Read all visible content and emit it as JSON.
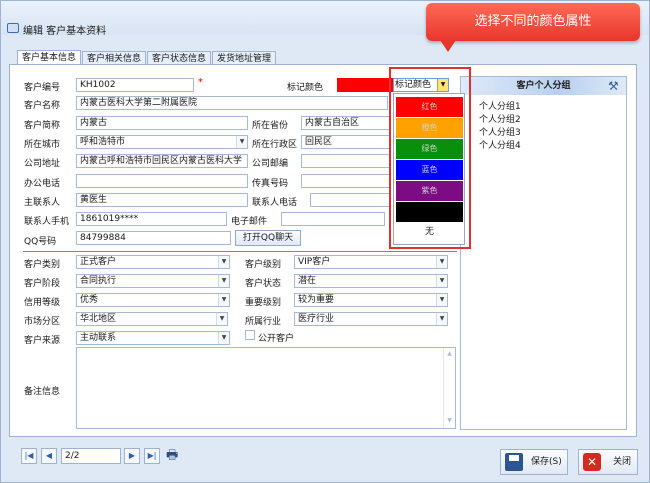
{
  "window": {
    "title": "编辑 客户基本资料"
  },
  "callout": {
    "text": "选择不同的颜色属性"
  },
  "tabs": [
    {
      "label": "客户基本信息"
    },
    {
      "label": "客户相关信息"
    },
    {
      "label": "客户状态信息"
    },
    {
      "label": "发货地址管理"
    }
  ],
  "form": {
    "customer_no_label": "客户编号",
    "customer_no": "KH1002",
    "mark_color_label": "标记颜色",
    "mark_color_value": "标记颜色",
    "customer_name_label": "客户名称",
    "customer_name": "内蒙古医科大学第二附属医院",
    "short_name_label": "客户简称",
    "short_name": "内蒙古",
    "province_label": "所在省份",
    "province": "内蒙古自治区",
    "city_label": "所在城市",
    "city": "呼和浩特市",
    "district_label": "所在行政区",
    "district": "回民区",
    "address_label": "公司地址",
    "address": "内蒙古呼和浩特市回民区内蒙古医科大学",
    "postcode_label": "公司邮编",
    "postcode": "",
    "office_phone_label": "办公电话",
    "office_phone": "",
    "fax_label": "传真号码",
    "fax": "",
    "contact_label": "主联系人",
    "contact": "黄医生",
    "contact_phone_label": "联系人电话",
    "contact_phone": "",
    "mobile_label": "联系人手机",
    "mobile": "1861019****",
    "email_label": "电子邮件",
    "email": "",
    "qq_label": "QQ号码",
    "qq": "84799884",
    "qq_button": "打开QQ聊天",
    "type_label": "客户类别",
    "type": "正式客户",
    "level_label": "客户级别",
    "level": "VIP客户",
    "stage_label": "客户阶段",
    "stage": "合同执行",
    "status_label": "客户状态",
    "status": "潜在",
    "credit_label": "信用等级",
    "credit": "优秀",
    "importance_label": "重要级别",
    "importance": "较为重要",
    "market_label": "市场分区",
    "market": "华北地区",
    "industry_label": "所属行业",
    "industry": "医疗行业",
    "source_label": "客户来源",
    "source": "主动联系",
    "public_label": "公开客户",
    "memo_label": "备注信息"
  },
  "color_options": [
    {
      "label": "红色",
      "color": "#ff0000"
    },
    {
      "label": "橙色",
      "color": "#ffa200"
    },
    {
      "label": "绿色",
      "color": "#0a8f0a"
    },
    {
      "label": "蓝色",
      "color": "#0000ff"
    },
    {
      "label": "紫色",
      "color": "#7d0c84"
    },
    {
      "label": "",
      "color": "#000000"
    }
  ],
  "color_none": "无",
  "groups": {
    "header": "客户个人分组",
    "items": [
      "个人分组1",
      "个人分组2",
      "个人分组3",
      "个人分组4"
    ]
  },
  "footer": {
    "page": "2/2",
    "save": "保存(S)",
    "close": "关闭"
  }
}
